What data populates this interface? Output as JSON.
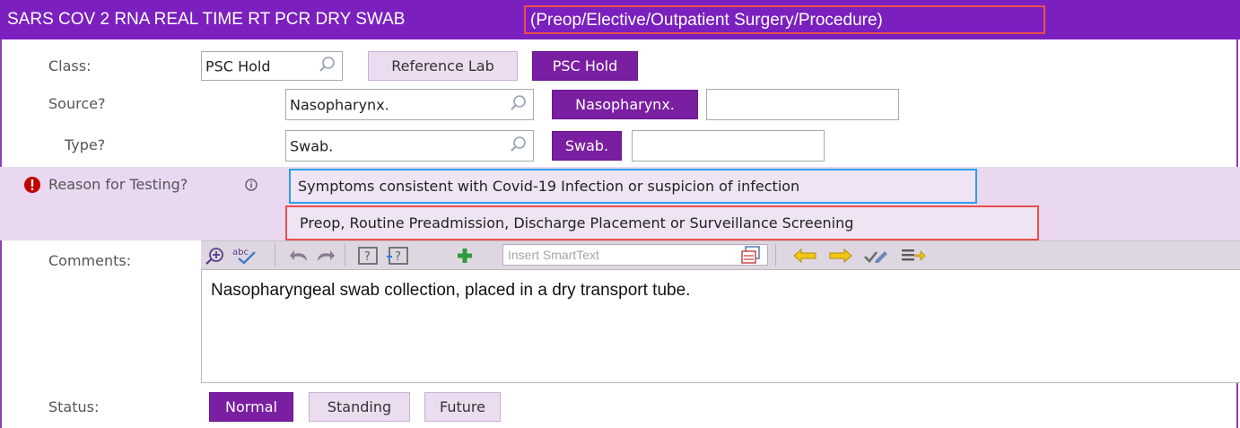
{
  "header": {
    "title": "SARS COV 2 RNA REAL TIME RT PCR DRY SWAB",
    "title_suffix": "(Preop/Elective/Outpatient Surgery/Procedure)"
  },
  "class_row": {
    "label": "Class:",
    "value": "PSC Hold",
    "options": [
      "Reference Lab",
      "PSC Hold"
    ],
    "selected": "PSC Hold"
  },
  "source_row": {
    "label": "Source?",
    "value": "Nasopharynx.",
    "quick_button": "Nasopharynx.",
    "extra_value": ""
  },
  "type_row": {
    "label": "Type?",
    "value": "Swab.",
    "quick_button": "Swab.",
    "extra_value": ""
  },
  "reason_row": {
    "label": "Reason for Testing?",
    "options": [
      "Symptoms consistent with Covid-19 Infection or suspicion of infection",
      "Preop, Routine Preadmission, Discharge Placement or Surveillance Screening"
    ]
  },
  "comments": {
    "label": "Comments:",
    "smarttext_placeholder": "Insert SmartText",
    "text": "Nasopharyngeal swab collection, placed in a dry transport tube."
  },
  "status_row": {
    "label": "Status:",
    "options": [
      "Normal",
      "Standing",
      "Future"
    ],
    "selected": "Normal"
  },
  "colors": {
    "title_bg": "#7b1fbe",
    "selected_button": "#7b1fa2",
    "unselected_button": "#ecdcef",
    "reason_band": "#ead8f1",
    "highlight_red": "#e8504b",
    "highlight_blue": "#2e9fe6",
    "required_icon": "#c00000"
  },
  "icons": {
    "field_lookup": "magnifier-icon",
    "required": "exclamation-circle-icon",
    "info": "info-icon",
    "toolbar": [
      "zoom-in-icon",
      "spellcheck-icon",
      "undo-icon",
      "redo-icon",
      "help-icon",
      "smart-help-icon",
      "add-icon",
      "smartlist-icon",
      "arrow-left-icon",
      "arrow-right-icon",
      "check-edit-icon",
      "list-arrow-icon"
    ]
  }
}
